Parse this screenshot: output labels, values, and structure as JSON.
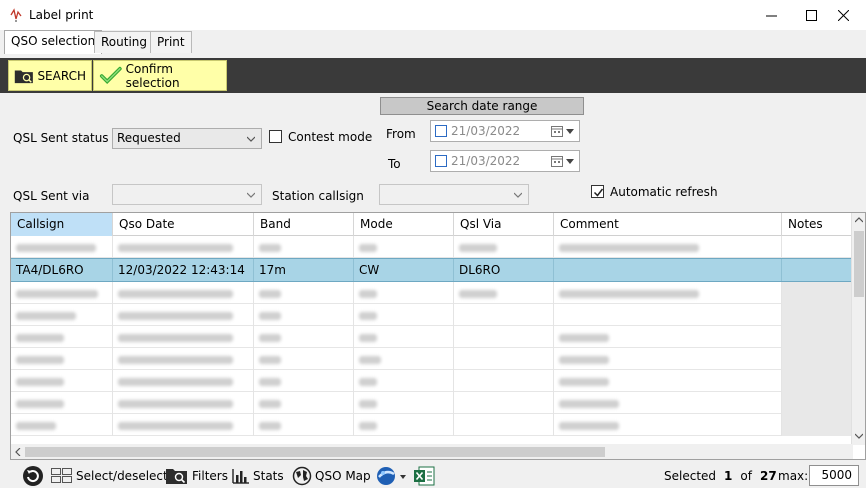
{
  "window": {
    "title": "Label print"
  },
  "tabs": [
    {
      "label": "QSO selection",
      "active": true
    },
    {
      "label": "Routing",
      "active": false
    },
    {
      "label": "Print",
      "active": false
    }
  ],
  "toolbar": {
    "search_label": "SEARCH",
    "confirm_label": "Confirm selection"
  },
  "filters": {
    "qsl_sent_status_label": "QSL Sent status",
    "qsl_sent_status_value": "Requested",
    "contest_mode_label": "Contest mode",
    "contest_mode_checked": false,
    "qsl_sent_via_label": "QSL Sent via",
    "qsl_sent_via_value": "",
    "station_callsign_label": "Station callsign",
    "station_callsign_value": "",
    "automatic_refresh_label": "Automatic refresh",
    "automatic_refresh_checked": true
  },
  "date_range": {
    "header": "Search date range",
    "from_label": "From",
    "from_value": "21/03/2022",
    "to_label": "To",
    "to_value": "21/03/2022"
  },
  "grid": {
    "columns": [
      "Callsign",
      "Qso Date",
      "Band",
      "Mode",
      "Qsl Via",
      "Comment",
      "Notes"
    ],
    "selected_row": {
      "callsign": "TA4/DL6RO",
      "qso_date": "12/03/2022 12:43:14",
      "band": "17m",
      "mode": "CW",
      "qsl_via": "DL6RO",
      "comment": "",
      "notes": ""
    }
  },
  "statusbar": {
    "select_deselect": "Select/deselect",
    "filters": "Filters",
    "stats": "Stats",
    "qso_map": "QSO Map",
    "selected_label": "Selected",
    "selected_count": "1",
    "of_label": "of",
    "total_count": "27",
    "max_label": "max:",
    "max_value": "5000"
  },
  "colors": {
    "toolbar_bg": "#3a3a3a",
    "button_bg": "#ffffa8",
    "selected_row": "#a8d4e6",
    "selected_header": "#bfe0f7"
  }
}
